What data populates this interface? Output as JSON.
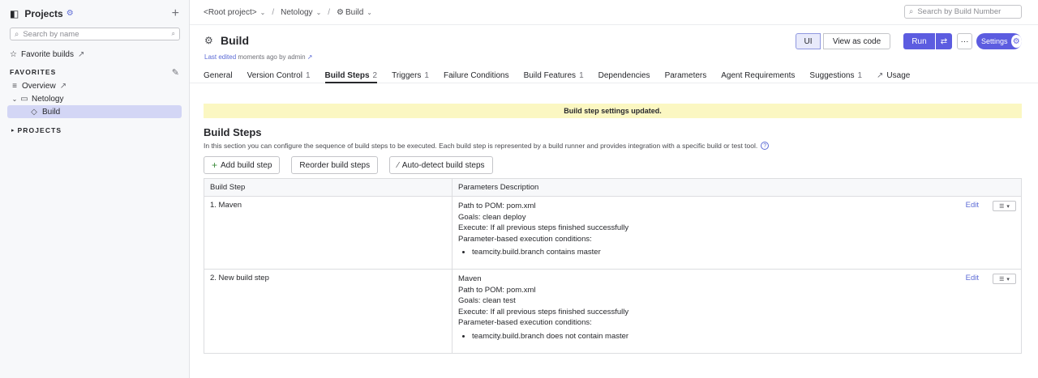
{
  "sidebar": {
    "title": "Projects",
    "search_placeholder": "Search by name",
    "favorite_builds": "Favorite builds",
    "favorites_label": "FAVORITES",
    "tree": [
      {
        "label": "Overview"
      },
      {
        "label": "Netology"
      },
      {
        "label": "Build"
      }
    ],
    "projects_label": "PROJECTS"
  },
  "breadcrumb": {
    "root": "<Root project>",
    "project": "Netology",
    "build": "Build"
  },
  "top_search_placeholder": "Search by Build Number",
  "header": {
    "title": "Build",
    "last_edited_prefix": "Last edited",
    "last_edited_rest": "moments ago by admin",
    "ui_label": "UI",
    "view_as_code_label": "View as code",
    "run_label": "Run",
    "more_label": "···",
    "settings_label": "Settings"
  },
  "tabs": [
    {
      "label": "General",
      "count": ""
    },
    {
      "label": "Version Control",
      "count": "1"
    },
    {
      "label": "Build Steps",
      "count": "2"
    },
    {
      "label": "Triggers",
      "count": "1"
    },
    {
      "label": "Failure Conditions",
      "count": ""
    },
    {
      "label": "Build Features",
      "count": "1"
    },
    {
      "label": "Dependencies",
      "count": ""
    },
    {
      "label": "Parameters",
      "count": ""
    },
    {
      "label": "Agent Requirements",
      "count": ""
    },
    {
      "label": "Suggestions",
      "count": "1"
    },
    {
      "label": "Usage",
      "count": ""
    }
  ],
  "banner": "Build step settings updated.",
  "section": {
    "title": "Build Steps",
    "description": "In this section you can configure the sequence of build steps to be executed. Each build step is represented by a build runner and provides integration with a specific build or test tool.",
    "add_label": "Add build step",
    "reorder_label": "Reorder build steps",
    "autodetect_label": "Auto-detect build steps"
  },
  "table": {
    "headers": [
      "Build Step",
      "Parameters Description"
    ],
    "rows": [
      {
        "step": "1. Maven",
        "lines": [
          "Path to POM: pom.xml",
          "Goals: clean deploy",
          "Execute: If all previous steps finished successfully",
          "Parameter-based execution conditions:"
        ],
        "condition": "teamcity.build.branch contains master",
        "edit": "Edit"
      },
      {
        "step": "2. New build step",
        "lines": [
          "Maven",
          "Path to POM: pom.xml",
          "Goals: clean test",
          "Execute: If all previous steps finished successfully",
          "Parameter-based execution conditions:"
        ],
        "condition": "teamcity.build.branch does not contain master",
        "edit": "Edit"
      }
    ]
  }
}
